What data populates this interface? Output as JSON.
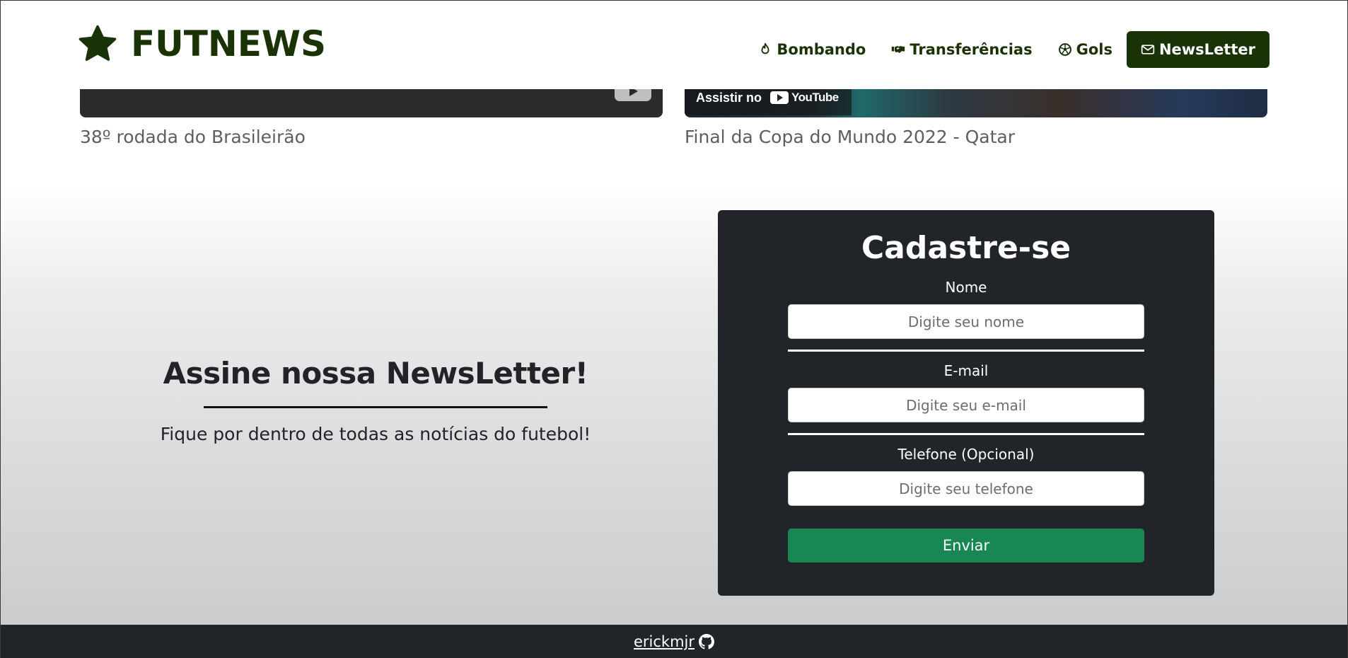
{
  "header": {
    "brand": "FUTNEWS",
    "brand_icon": "star-icon",
    "nav": [
      {
        "label": "Bombando",
        "icon": "fire-icon"
      },
      {
        "label": "Transferências",
        "icon": "handshake-icon"
      },
      {
        "label": "Gols",
        "icon": "soccer-ball-icon"
      },
      {
        "label": "NewsLetter",
        "icon": "envelope-icon",
        "active": true
      }
    ]
  },
  "videos": [
    {
      "caption": "38º rodada do Brasileirão"
    },
    {
      "caption": "Final da Copa do Mundo 2022 - Qatar",
      "watch_on": "Assistir no",
      "platform": "YouTube"
    }
  ],
  "newsletter": {
    "heading": "Assine nossa NewsLetter!",
    "subtitle": "Fique por dentro de todas as notícias do futebol!",
    "form": {
      "title": "Cadastre-se",
      "name_label": "Nome",
      "name_placeholder": "Digite seu nome",
      "email_label": "E-mail",
      "email_placeholder": "Digite seu e-mail",
      "phone_label": "Telefone (Opcional)",
      "phone_placeholder": "Digite seu telefone",
      "submit_label": "Enviar"
    }
  },
  "footer": {
    "author": "erickmjr",
    "icon": "github-icon"
  },
  "colors": {
    "brand": "#1a3306",
    "card": "#212429",
    "submit": "#198754"
  }
}
